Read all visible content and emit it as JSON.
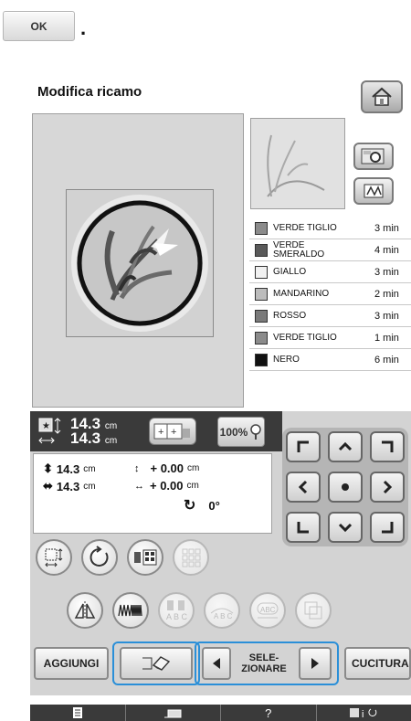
{
  "instruction": {
    "ok_label": "OK",
    "trailing_punct": "."
  },
  "screen": {
    "title": "Modifica ricamo"
  },
  "threads": [
    {
      "name": "VERDE TIGLIO",
      "time": "3 min",
      "color": "#8b8b8b"
    },
    {
      "name": "VERDE SMERALDO",
      "time": "4 min",
      "color": "#5a5a5a"
    },
    {
      "name": "GIALLO",
      "time": "3 min",
      "color": "#f1f1f1"
    },
    {
      "name": "MANDARINO",
      "time": "2 min",
      "color": "#bcbcbc"
    },
    {
      "name": "ROSSO",
      "time": "3 min",
      "color": "#7a7a7a"
    },
    {
      "name": "VERDE TIGLIO",
      "time": "1 min",
      "color": "#8b8b8b"
    },
    {
      "name": "NERO",
      "time": "6 min",
      "color": "#111111"
    }
  ],
  "size": {
    "width_value": "14.3",
    "height_value": "14.3",
    "unit": "cm",
    "zoom": "100%"
  },
  "info": {
    "height": "14.3",
    "width": "14.3",
    "unit": "cm",
    "offset_v": "+ 0.00",
    "offset_h": "+ 0.00",
    "rotation": "0°"
  },
  "bottom_row": {
    "aggiungi": "AGGIUNGI",
    "selezionare": "SELE-\nZIONARE",
    "cucitura": "CUCITURA"
  },
  "bottom_bar": {
    "help": "?"
  },
  "colors": {
    "highlight": "#2a8fd8",
    "panel": "#d3d3d3",
    "dark_bar": "#3a3a3a"
  }
}
